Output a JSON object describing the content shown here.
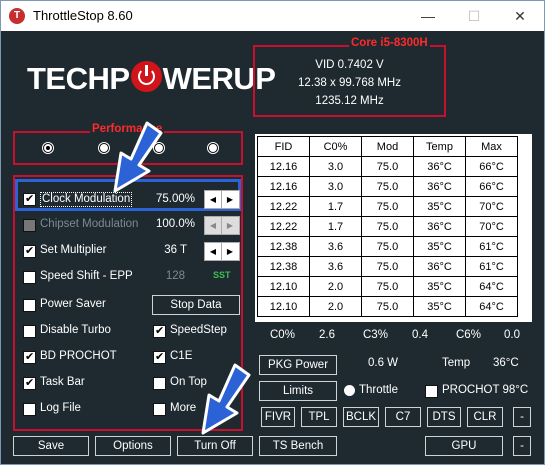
{
  "window": {
    "title": "ThrottleStop 8.60",
    "icon_letter": "T",
    "minimize_label": "—",
    "maximize_label": "☐",
    "close_label": "✕"
  },
  "logo": {
    "text_left": "TECHP",
    "text_right": "WERUP"
  },
  "cpu": {
    "title": "Core i5-8300H",
    "vid": "VID  0.7402 V",
    "multiplier_line": "12.38 x 99.768 MHz",
    "frequency": "1235.12 MHz"
  },
  "performance": {
    "title": "Performance",
    "profiles": 4,
    "selected": 0
  },
  "settings": {
    "clock_modulation": {
      "label": "Clock Modulation",
      "value": "75.00%",
      "checked": true
    },
    "chipset_modulation": {
      "label": "Chipset Modulation",
      "value": "100.0%",
      "checked": false,
      "disabled": true
    },
    "set_multiplier": {
      "label": "Set Multiplier",
      "value": "36 T",
      "checked": true
    },
    "speed_shift": {
      "label": "Speed Shift - EPP",
      "value": "128",
      "tag": "SST",
      "checked": false
    },
    "power_saver": {
      "label": "Power Saver",
      "checked": false
    },
    "stop_data_label": "Stop Data",
    "disable_turbo": {
      "label": "Disable Turbo",
      "checked": false
    },
    "speedstep": {
      "label": "SpeedStep",
      "checked": true
    },
    "bd_prochot": {
      "label": "BD PROCHOT",
      "checked": true
    },
    "c1e": {
      "label": "C1E",
      "checked": true
    },
    "task_bar": {
      "label": "Task Bar",
      "checked": true
    },
    "on_top": {
      "label": "On Top",
      "checked": false
    },
    "log_file": {
      "label": "Log File",
      "checked": false
    },
    "more": {
      "label": "More",
      "checked": false
    }
  },
  "fid_table": {
    "headers": [
      "FID",
      "C0%",
      "Mod",
      "Temp",
      "Max"
    ],
    "rows": [
      [
        "12.16",
        "3.0",
        "75.0",
        "36°C",
        "66°C"
      ],
      [
        "12.16",
        "3.0",
        "75.0",
        "36°C",
        "66°C"
      ],
      [
        "12.22",
        "1.7",
        "75.0",
        "35°C",
        "70°C"
      ],
      [
        "12.22",
        "1.7",
        "75.0",
        "36°C",
        "70°C"
      ],
      [
        "12.38",
        "3.6",
        "75.0",
        "35°C",
        "61°C"
      ],
      [
        "12.38",
        "3.6",
        "75.0",
        "36°C",
        "61°C"
      ],
      [
        "12.10",
        "2.0",
        "75.0",
        "35°C",
        "64°C"
      ],
      [
        "12.10",
        "2.0",
        "75.0",
        "35°C",
        "64°C"
      ]
    ]
  },
  "cstates": {
    "c0_label": "C0%",
    "c0_value": "2.6",
    "c3_label": "C3%",
    "c3_value": "0.4",
    "c6_label": "C6%",
    "c6_value": "0.0"
  },
  "power": {
    "pkg_power_label": "PKG Power",
    "pkg_power_value": "0.6 W",
    "temp_label": "Temp",
    "temp_value": "36°C",
    "limits_label": "Limits",
    "throttle_label": "Throttle",
    "prochot_label": "PROCHOT 98°C"
  },
  "tools": [
    "FIVR",
    "TPL",
    "BCLK",
    "C7",
    "DTS",
    "CLR",
    "-"
  ],
  "bottom": {
    "save": "Save",
    "options": "Options",
    "turn_off": "Turn Off",
    "ts_bench": "TS Bench",
    "gpu": "GPU",
    "dash": "-"
  },
  "colors": {
    "background": "#1f2a30",
    "accent_red": "#c8102e",
    "highlight_blue": "#2b63d6",
    "sst_green": "#3fbf4f"
  }
}
